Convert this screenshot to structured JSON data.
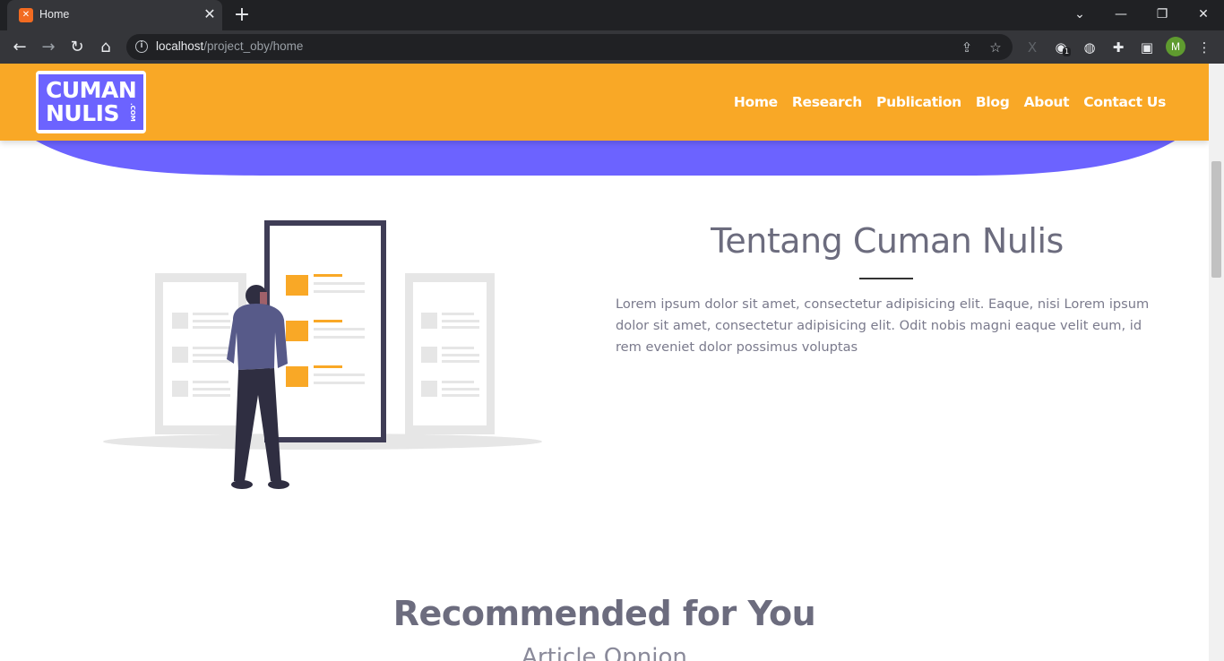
{
  "browser": {
    "tab_title": "Home",
    "url_host": "localhost",
    "url_path": "/project_oby/home",
    "profile_initial": "M",
    "extension_badge": "1"
  },
  "navbar": {
    "logo_line1": "CUMAN",
    "logo_line2": "NULIS",
    "logo_suffix": ".COM",
    "menu": [
      {
        "label": "Home"
      },
      {
        "label": "Research"
      },
      {
        "label": "Publication"
      },
      {
        "label": "Blog"
      },
      {
        "label": "About"
      },
      {
        "label": "Contact Us"
      }
    ],
    "bg_color": "#f9a826"
  },
  "about": {
    "title": "Tentang Cuman Nulis",
    "body": "Lorem ipsum dolor sit amet, consectetur adipisicing elit. Eaque, nisi Lorem ipsum dolor sit amet, consectetur adipisicing elit. Odit nobis magni eaque velit eum, id rem eveniet dolor possimus voluptas"
  },
  "recommended": {
    "title": "Recommended for You",
    "subtitle": "Article Opnion"
  },
  "colors": {
    "accent_purple": "#6c63ff",
    "accent_orange": "#f9a826"
  }
}
